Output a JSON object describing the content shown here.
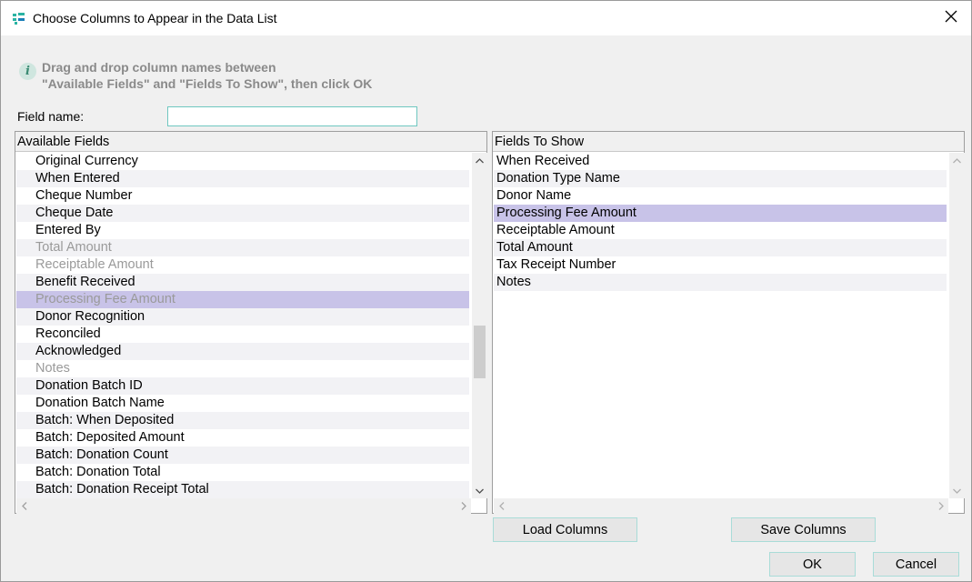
{
  "window": {
    "title": "Choose Columns to Appear in the Data List"
  },
  "info": {
    "line1": "Drag and drop column names between",
    "line2": "\"Available Fields\" and \"Fields To Show\", then click OK"
  },
  "field_name": {
    "label": "Field name:",
    "value": ""
  },
  "available_fields": {
    "header": "Available Fields",
    "items": [
      {
        "label": "Original Currency",
        "state": "normal"
      },
      {
        "label": "When Entered",
        "state": "normal"
      },
      {
        "label": "Cheque Number",
        "state": "normal"
      },
      {
        "label": "Cheque Date",
        "state": "normal"
      },
      {
        "label": "Entered By",
        "state": "normal"
      },
      {
        "label": "Total Amount",
        "state": "disabled"
      },
      {
        "label": "Receiptable Amount",
        "state": "disabled"
      },
      {
        "label": "Benefit Received",
        "state": "normal"
      },
      {
        "label": "Processing Fee Amount",
        "state": "selected-disabled"
      },
      {
        "label": "Donor Recognition",
        "state": "normal"
      },
      {
        "label": "Reconciled",
        "state": "normal"
      },
      {
        "label": "Acknowledged",
        "state": "normal"
      },
      {
        "label": "Notes",
        "state": "disabled"
      },
      {
        "label": "Donation Batch ID",
        "state": "normal"
      },
      {
        "label": "Donation Batch Name",
        "state": "normal"
      },
      {
        "label": "Batch: When Deposited",
        "state": "normal"
      },
      {
        "label": "Batch: Deposited Amount",
        "state": "normal"
      },
      {
        "label": "Batch: Donation Count",
        "state": "normal"
      },
      {
        "label": "Batch: Donation Total",
        "state": "normal"
      },
      {
        "label": "Batch: Donation Receipt Total",
        "state": "normal"
      }
    ]
  },
  "fields_to_show": {
    "header": "Fields To Show",
    "items": [
      {
        "label": "When Received",
        "state": "normal"
      },
      {
        "label": "Donation Type Name",
        "state": "normal"
      },
      {
        "label": "Donor Name",
        "state": "normal"
      },
      {
        "label": "Processing Fee Amount",
        "state": "selected"
      },
      {
        "label": "Receiptable Amount",
        "state": "normal"
      },
      {
        "label": "Total Amount",
        "state": "normal"
      },
      {
        "label": "Tax Receipt Number",
        "state": "normal"
      },
      {
        "label": "Notes",
        "state": "normal"
      }
    ]
  },
  "buttons": {
    "load_columns": "Load Columns",
    "save_columns": "Save Columns",
    "ok": "OK",
    "cancel": "Cancel"
  },
  "colors": {
    "selection": "#c8c3e8",
    "disabled_text": "#9a9a9a",
    "accent_border": "#a9dcd8"
  }
}
